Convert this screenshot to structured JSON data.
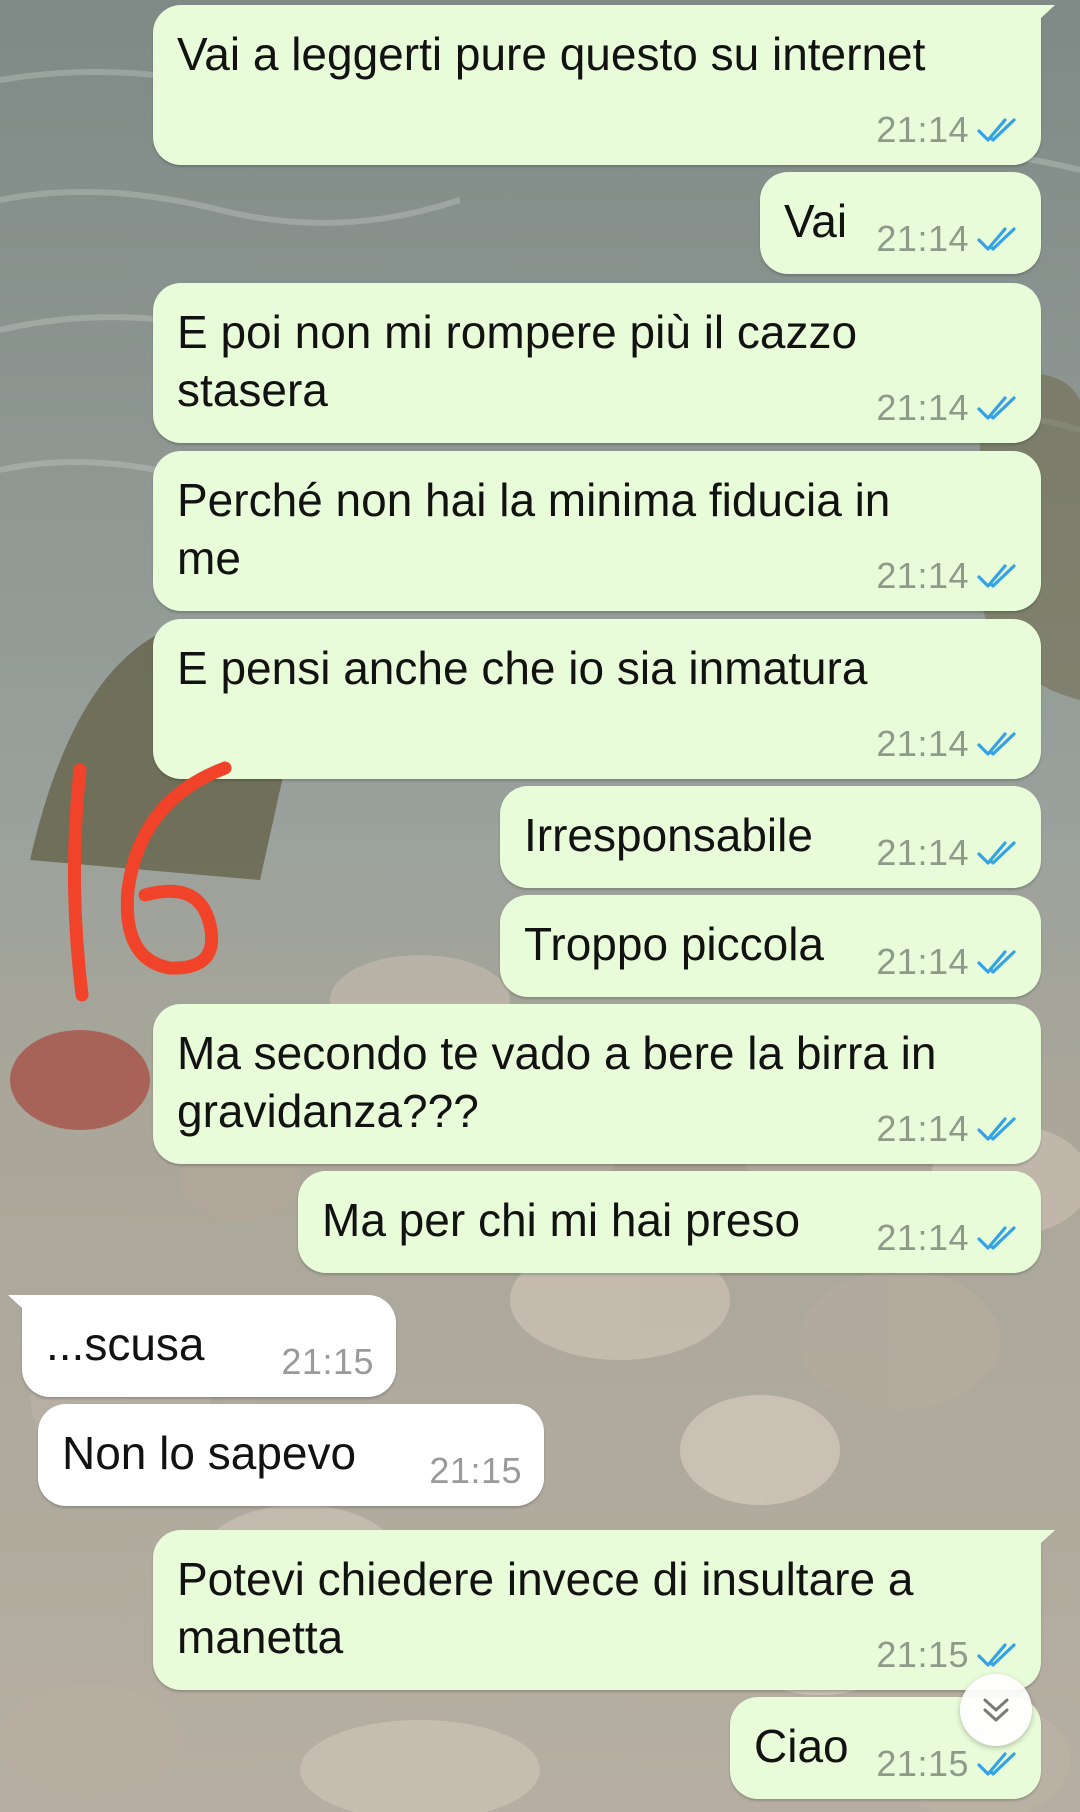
{
  "theme": {
    "outgoing_bubble": "#e9fcd9",
    "incoming_bubble": "#ffffff",
    "read_tick_color": "#34a3e6",
    "annotation_color": "#f0432a"
  },
  "messages": [
    {
      "direction": "out",
      "text": "Vai a leggerti pure questo su internet",
      "time": "21:14",
      "status": "read"
    },
    {
      "direction": "out",
      "text": "Vai",
      "time": "21:14",
      "status": "read"
    },
    {
      "direction": "out",
      "text": "E poi non mi rompere più il cazzo\nstasera",
      "time": "21:14",
      "status": "read"
    },
    {
      "direction": "out",
      "text": "Perché non hai la minima fiducia in\nme",
      "time": "21:14",
      "status": "read"
    },
    {
      "direction": "out",
      "text": "E pensi anche che io sia inmatura",
      "time": "21:14",
      "status": "read"
    },
    {
      "direction": "out",
      "text": "Irresponsabile",
      "time": "21:14",
      "status": "read"
    },
    {
      "direction": "out",
      "text": "Troppo piccola",
      "time": "21:14",
      "status": "read"
    },
    {
      "direction": "out",
      "text": "Ma secondo te vado a bere la birra in\ngravidanza???",
      "time": "21:14",
      "status": "read"
    },
    {
      "direction": "out",
      "text": "Ma per chi mi hai preso",
      "time": "21:14",
      "status": "read"
    },
    {
      "direction": "in",
      "text": "...scusa",
      "time": "21:15"
    },
    {
      "direction": "in",
      "text": "Non lo sapevo",
      "time": "21:15"
    },
    {
      "direction": "out",
      "text": "Potevi chiedere invece di insultare a\nmanetta",
      "time": "21:15",
      "status": "read"
    },
    {
      "direction": "out",
      "text": "Ciao",
      "time": "21:15",
      "status": "read"
    }
  ],
  "annotation": {
    "text": "16",
    "style": "handwritten"
  },
  "scroll_button": {
    "icon": "double-chevron-down-icon"
  }
}
